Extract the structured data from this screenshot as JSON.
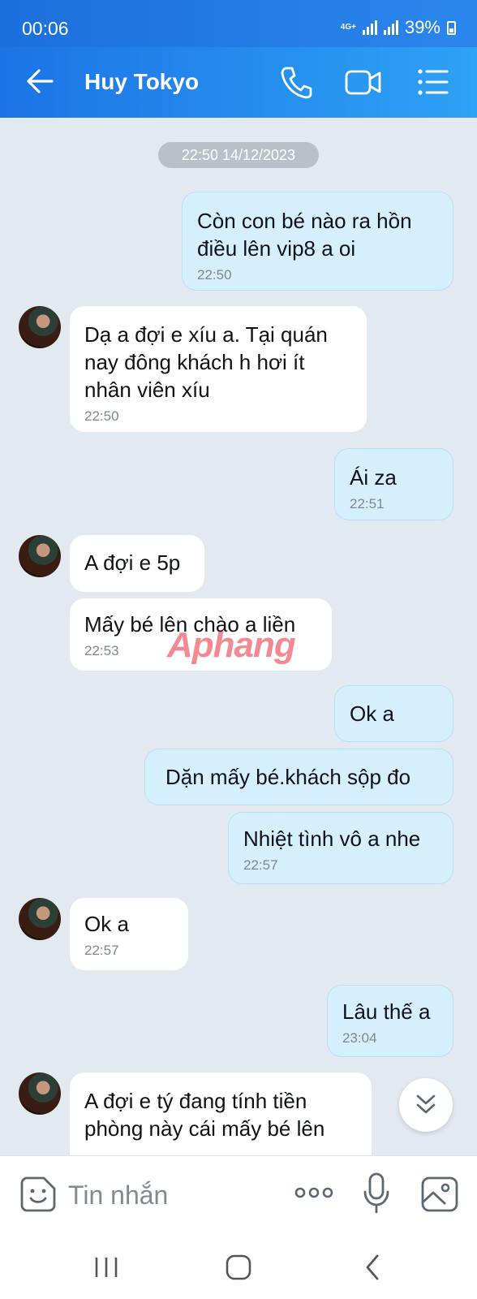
{
  "status_bar": {
    "time": "00:06",
    "network": "4G+",
    "battery": "39%"
  },
  "header": {
    "contact_name": "Huy Tokyo"
  },
  "chat": {
    "date_separator": "22:50 14/12/2023",
    "watermark": "Aphang",
    "messages": [
      {
        "dir": "out",
        "lines": [
          "Còn con bé nào ra hồn",
          "điều lên vip8 a oi"
        ],
        "time": "22:50"
      },
      {
        "dir": "in",
        "lines": [
          "Dạ a đợi e xíu a. Tại quán",
          "nay đông khách h hơi ít",
          "nhân viên xíu"
        ],
        "time": "22:50"
      },
      {
        "dir": "out",
        "lines": [
          "Ái za"
        ],
        "time": "22:51"
      },
      {
        "dir": "in",
        "lines": [
          "A đợi e 5p"
        ],
        "time": ""
      },
      {
        "dir": "in",
        "lines": [
          "Mấy bé lên chào a liền"
        ],
        "time": "22:53"
      },
      {
        "dir": "out",
        "lines": [
          "Ok a"
        ],
        "time": ""
      },
      {
        "dir": "out",
        "lines": [
          "Dặn mấy bé.khách sộp đo"
        ],
        "time": ""
      },
      {
        "dir": "out",
        "lines": [
          "Nhiệt tình vô a nhe"
        ],
        "time": "22:57"
      },
      {
        "dir": "in",
        "lines": [
          "Ok a"
        ],
        "time": "22:57"
      },
      {
        "dir": "out",
        "lines": [
          "Lâu thế a"
        ],
        "time": "23:04"
      },
      {
        "dir": "in",
        "lines": [
          "A đợi e tý đang tính tiền",
          "phòng này cái mấy bé lên"
        ],
        "time": ""
      }
    ]
  },
  "input": {
    "placeholder": "Tin nhắn"
  },
  "icons": {
    "back": "arrow-left-icon",
    "call": "phone-icon",
    "video": "video-call-icon",
    "menu": "list-menu-icon",
    "sticker": "sticker-icon",
    "more": "more-dots-icon",
    "mic": "microphone-icon",
    "image": "image-icon",
    "scroll": "chevron-double-down-icon",
    "nav_recent": "recent-apps-icon",
    "nav_home": "home-icon",
    "nav_back": "back-nav-icon"
  },
  "colors": {
    "header": "#2086ec",
    "outgoing_bubble": "#d6efff",
    "incoming_bubble": "#ffffff",
    "chat_background": "#e2e9f1"
  }
}
